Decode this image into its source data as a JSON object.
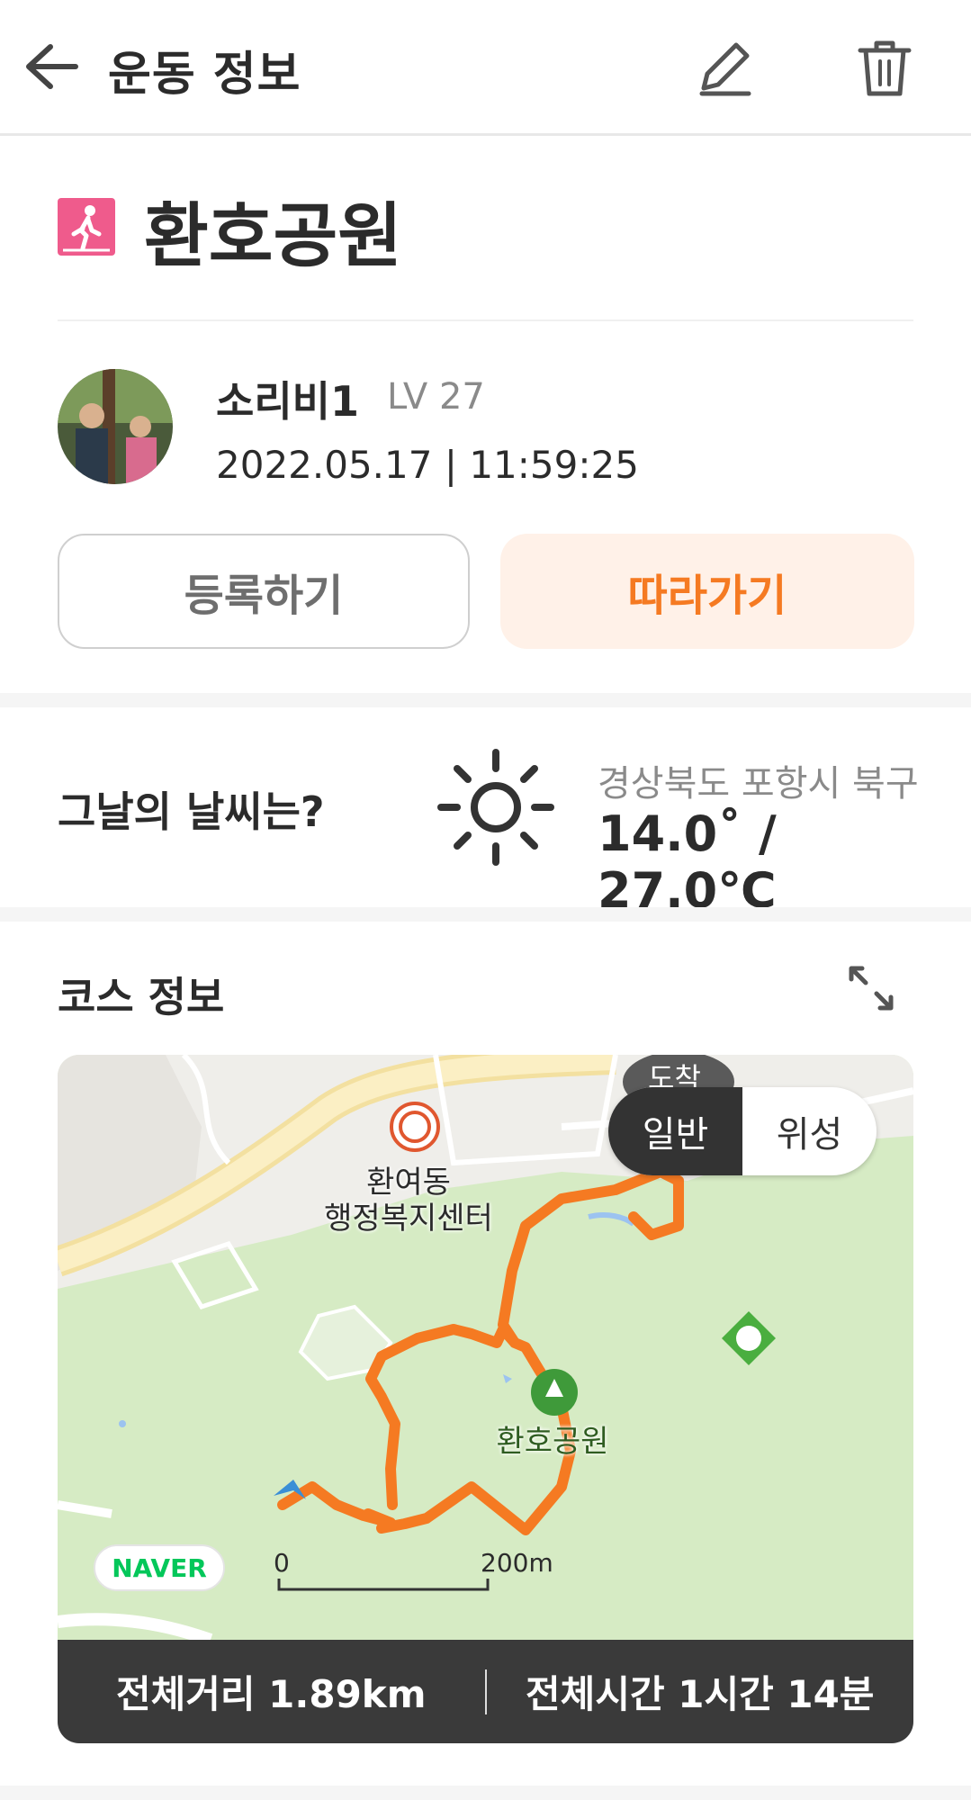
{
  "header": {
    "title": "운동 정보"
  },
  "course": {
    "name": "환호공원",
    "icon": "walking-icon"
  },
  "user": {
    "name": "소리비1",
    "level": "LV 27",
    "datetime": "2022.05.17 | 11:59:25"
  },
  "buttons": {
    "register": "등록하기",
    "follow": "따라가기"
  },
  "weather": {
    "question": "그날의 날씨는?",
    "location": "경상북도 포항시 북구",
    "temperature": "14.0˚ / 27.0℃",
    "icon": "sun-icon"
  },
  "course_info": {
    "title": "코스 정보"
  },
  "map": {
    "toggle_normal": "일반",
    "toggle_satellite": "위성",
    "label_center_line1": "환여동",
    "label_center_line2": "행정복지센터",
    "label_park": "환호공원",
    "label_partial": "도착",
    "naver": "NAVER",
    "scale_start": "0",
    "scale_end": "200m"
  },
  "stats": {
    "distance": "전체거리 1.89km",
    "time": "전체시간 1시간 14분"
  },
  "colors": {
    "accent": "#f57a22",
    "follow_bg": "#fff1e8",
    "icon_pink": "#ef5b8c",
    "map_green": "#d6ebc4",
    "route": "#f57a22"
  }
}
